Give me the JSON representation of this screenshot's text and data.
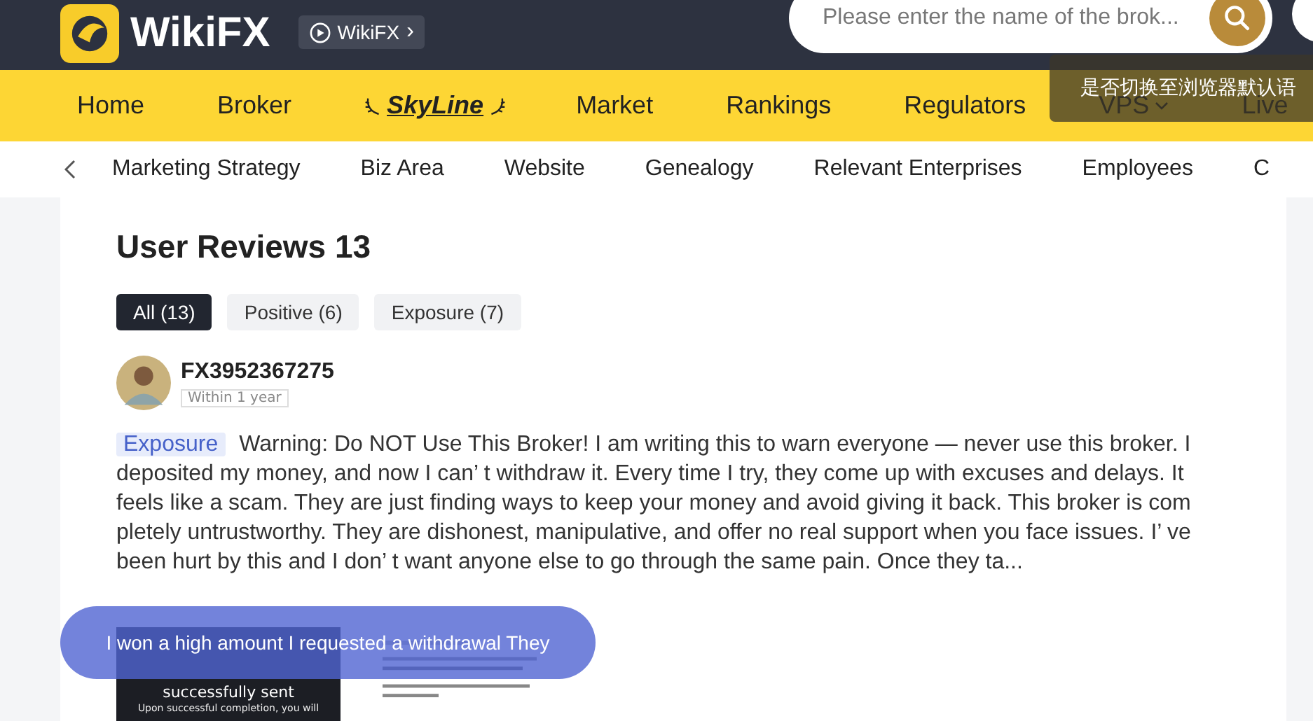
{
  "header": {
    "logo": "WikiFX",
    "app_link": "WikiFX",
    "app_link_arrow": "›",
    "search": {
      "placeholder": "Please enter the name of the brok..."
    }
  },
  "nav": [
    {
      "label": "Home",
      "kind": "text"
    },
    {
      "label": "Broker",
      "kind": "text"
    },
    {
      "label": "SkyLine",
      "kind": "logo"
    },
    {
      "label": "Market",
      "kind": "text"
    },
    {
      "label": "Rankings",
      "kind": "text"
    },
    {
      "label": "Regulators",
      "kind": "text"
    },
    {
      "label": "VPS",
      "kind": "dropdown"
    },
    {
      "label": "Live",
      "kind": "text"
    }
  ],
  "language_prompt": "是否切换至浏览器默认语",
  "subtabs": [
    {
      "label": "Marketing Strategy"
    },
    {
      "label": "Biz Area"
    },
    {
      "label": "Website"
    },
    {
      "label": "Genealogy"
    },
    {
      "label": "Relevant Enterprises"
    },
    {
      "label": "Employees"
    },
    {
      "label": "C"
    }
  ],
  "reviews_title": "User Reviews 13",
  "filters": [
    {
      "label": "All (13)",
      "selected": true
    },
    {
      "label": "Positive (6)",
      "selected": false
    },
    {
      "label": "Exposure (7)",
      "selected": false
    }
  ],
  "review": {
    "user": "FX3952367275",
    "period": "Within 1 year",
    "tag": "Exposure",
    "text": "Warning: Do NOT Use This Broker! I am writing this to warn everyone — never use this broker. I deposited my money, and now I can’ t withdraw it. Every time I try, they come up with excuses and delays. It feels like a scam. They are just finding ways to keep your money and avoid giving it back. This broker is completely untrustworthy. They are dishonest, manipulative, and offer no real support when you face issues. I’ ve been hurt by this and I don’ t want anyone else to go through the same pain. Once they ta...",
    "screenshot": {
      "title": "successfully sent",
      "body": "Upon successful completion, you will"
    }
  },
  "toast": "I won a high amount I requested a withdrawal They"
}
